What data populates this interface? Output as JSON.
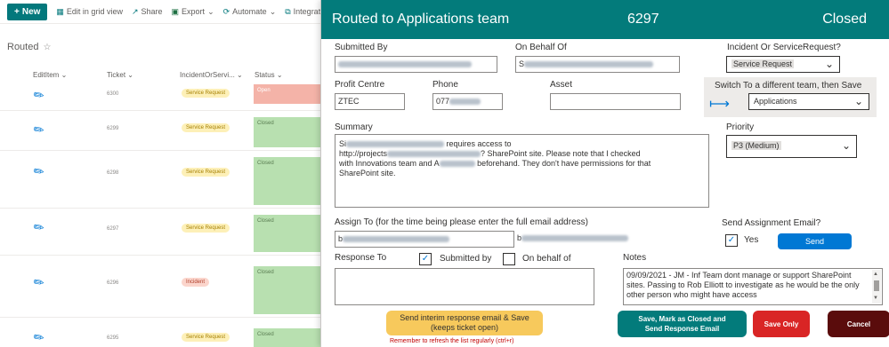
{
  "toolbar": {
    "new_label": "New",
    "edit_grid_label": "Edit in grid view",
    "share_label": "Share",
    "export_label": "Export",
    "automate_label": "Automate",
    "integrate_label": "Integrate"
  },
  "view": {
    "title": "Routed"
  },
  "columns": {
    "edit": "EditItem",
    "ticket": "Ticket",
    "type": "IncidentOrServi...",
    "status": "Status"
  },
  "rows": [
    {
      "ticket": "6300",
      "type": "Service Request",
      "status": "Open"
    },
    {
      "ticket": "6299",
      "type": "Service Request",
      "status": "Closed"
    },
    {
      "ticket": "6298",
      "type": "Service Request",
      "status": "Closed"
    },
    {
      "ticket": "6297",
      "type": "Service Request",
      "status": "Closed"
    },
    {
      "ticket": "6296",
      "type": "Incident",
      "status": "Closed"
    },
    {
      "ticket": "6295",
      "type": "Service Request",
      "status": "Closed"
    }
  ],
  "form": {
    "title": "Routed to Applications team",
    "ticket_number": "6297",
    "state": "Closed",
    "submitted_by_label": "Submitted By",
    "on_behalf_label": "On Behalf Of",
    "on_behalf_prefix": "S",
    "type_label": "Incident Or ServiceRequest?",
    "type_value": "Service Request",
    "profit_centre_label": "Profit Centre",
    "profit_centre_value": "ZTEC",
    "phone_label": "Phone",
    "phone_value": "077",
    "asset_label": "Asset",
    "switch_label": "Switch To a different team, then Save",
    "team_value": "Applications",
    "summary_label": "Summary",
    "summary_line1_prefix": "Si",
    "summary_line1_suffix": "requires access to",
    "summary_line2_prefix": "http://projects",
    "summary_line2_suffix": "? SharePoint site. Please note that I checked",
    "summary_line3_prefix": "with Innovations team and A",
    "summary_line3_suffix": "beforehand. They don't have permissions for that",
    "summary_line4": "SharePoint site.",
    "priority_label": "Priority",
    "priority_value": "P3 (Medium)",
    "assign_label": "Assign To (for the time being please enter the full email address)",
    "assign_prefix": "b",
    "assign_suffix": "b",
    "send_email_label": "Send Assignment Email?",
    "yes_label": "Yes",
    "send_button": "Send",
    "response_to_label": "Response To",
    "submitted_by_option": "Submitted by",
    "on_behalf_option": "On behalf of",
    "notes_label": "Notes",
    "notes_text": "09/09/2021 - JM - Inf Team dont manage or support SharePoint sites. Passing to Rob Elliott to investigate as he would be the only other person who might have access",
    "interim_button_line1": "Send interim response email & Save",
    "interim_button_line2": "(keeps ticket open)",
    "reminder": "Remember to refresh the list regularly (ctrl+r)",
    "close_button_line1": "Save, Mark as Closed and",
    "close_button_line2": "Send Response Email",
    "save_only_button": "Save Only",
    "cancel_button": "Cancel"
  },
  "colors": {
    "header_teal": "#037b7b",
    "send_blue": "#0078d4",
    "interim_yellow": "#f7c95c",
    "save_red": "#d92525",
    "cancel_dark": "#5a0c0c"
  }
}
